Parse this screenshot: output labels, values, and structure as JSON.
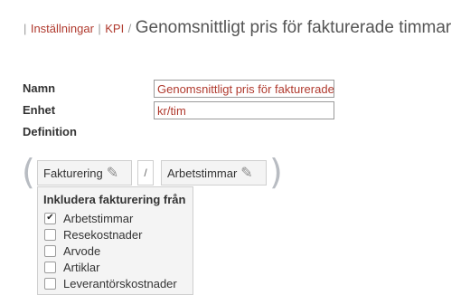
{
  "breadcrumb": {
    "sep": "|",
    "items": [
      "Inställningar",
      "KPI"
    ],
    "slash": "/",
    "title": "Genomsnittligt pris för fakturerade timmar"
  },
  "form": {
    "name_label": "Namn",
    "name_value": "Genomsnittligt pris för fakturerade timmar",
    "unit_label": "Enhet",
    "unit_value": "kr/tim",
    "definition_label": "Definition"
  },
  "formula": {
    "open_paren": "(",
    "close_paren": ")",
    "numerator": "Fakturering",
    "operator": "/",
    "denominator": "Arbetstimmar",
    "edit_icon": "pencil-icon"
  },
  "dropdown": {
    "heading": "Inkludera fakturering från",
    "options": [
      {
        "label": "Arbetstimmar",
        "checked": true
      },
      {
        "label": "Resekostnader",
        "checked": false
      },
      {
        "label": "Arvode",
        "checked": false
      },
      {
        "label": "Artiklar",
        "checked": false
      },
      {
        "label": "Leverantörskostnader",
        "checked": false
      }
    ]
  }
}
